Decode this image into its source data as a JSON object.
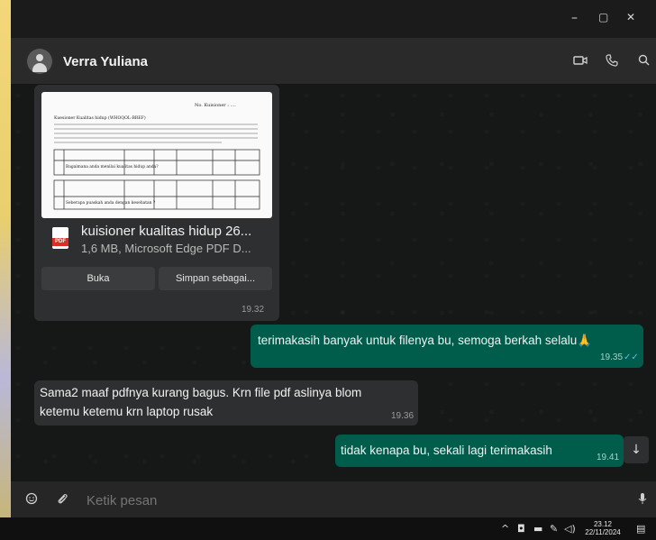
{
  "window": {
    "controls": {
      "minimize": "–",
      "maximize": "▢",
      "close": "✕"
    }
  },
  "header": {
    "contact_name": "Verra Yuliana",
    "icons": [
      "video-call-icon",
      "voice-call-icon",
      "search-icon"
    ]
  },
  "messages": {
    "document": {
      "file_name": "kuisioner kualitas hidup 26...",
      "file_meta": "1,6 MB, Microsoft Edge PDF D...",
      "pdf_badge": "PDF",
      "open_label": "Buka",
      "save_label": "Simpan sebagai...",
      "time": "19.32",
      "preview": {
        "header_right": "No. Kuisioner : ....",
        "title": "Kuesioner Kualitas hidup (WHOQOL-BREF)",
        "q1": "Bagaimana anda menilai kualitas hidup anda?",
        "q2": "Seberapa puaskah anda dengan kesehatan ?"
      }
    },
    "out1": {
      "text": "terimakasih banyak untuk filenya bu, semoga berkah selalu🙏",
      "time": "19.35"
    },
    "in1": {
      "line1": "Sama2 maaf pdfnya kurang bagus. Krn file pdf aslinya blom",
      "line2": "ketemu ketemu krn laptop rusak",
      "time": "19.36"
    },
    "out2": {
      "text": "tidak kenapa bu, sekali lagi terimakasih",
      "time": "19.41"
    }
  },
  "composer": {
    "placeholder": "Ketik pesan"
  },
  "taskbar": {
    "time": "23.12",
    "date": "22/11/2024"
  },
  "colors": {
    "outgoing_bubble": "#005c4b",
    "incoming_bubble": "#2e2f30",
    "read_ticks": "#53bdeb"
  }
}
